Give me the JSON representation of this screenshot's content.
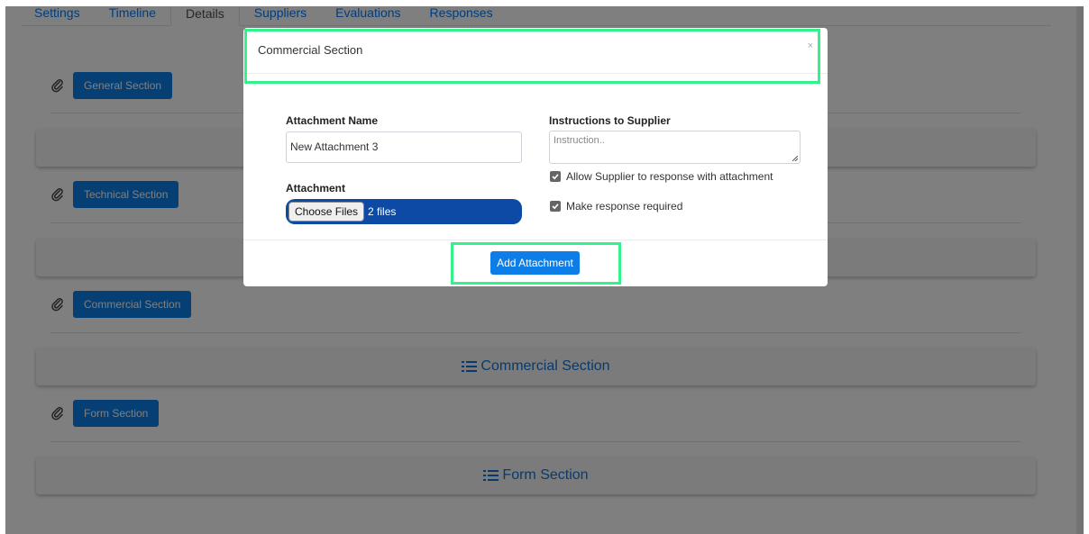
{
  "tabs": [
    "Settings",
    "Timeline",
    "Details",
    "Suppliers",
    "Evaluations",
    "Responses"
  ],
  "active_tab": "Details",
  "sections": {
    "general": {
      "button_label": "General Section"
    },
    "technical": {
      "button_label": "Technical Section"
    },
    "commercial": {
      "button_label": "Commercial Section",
      "bar_title": "Commercial Section"
    },
    "form": {
      "button_label": "Form Section",
      "bar_title": "Form Section"
    }
  },
  "modal": {
    "title": "Commercial Section",
    "close_label": "×",
    "attachment_name_label": "Attachment Name",
    "attachment_name_value": "New Attachment 3",
    "instructions_label": "Instructions to Supplier",
    "instructions_placeholder": "Instruction..",
    "attachment_label": "Attachment",
    "choose_files_label": "Choose Files",
    "file_status": "2 files",
    "allow_attachment_label": "Allow Supplier to response with attachment",
    "allow_attachment_checked": true,
    "required_label": "Make response required",
    "required_checked": true,
    "add_button_label": "Add Attachment"
  },
  "colors": {
    "primary": "#0d7ee8",
    "file_input": "#0c4aa6",
    "highlight": "#34f28a",
    "backdrop": "rgba(0,0,0,0.5)"
  },
  "icons": [
    "paperclip-icon",
    "list-icon",
    "close-icon",
    "checkbox-checked-icon"
  ]
}
